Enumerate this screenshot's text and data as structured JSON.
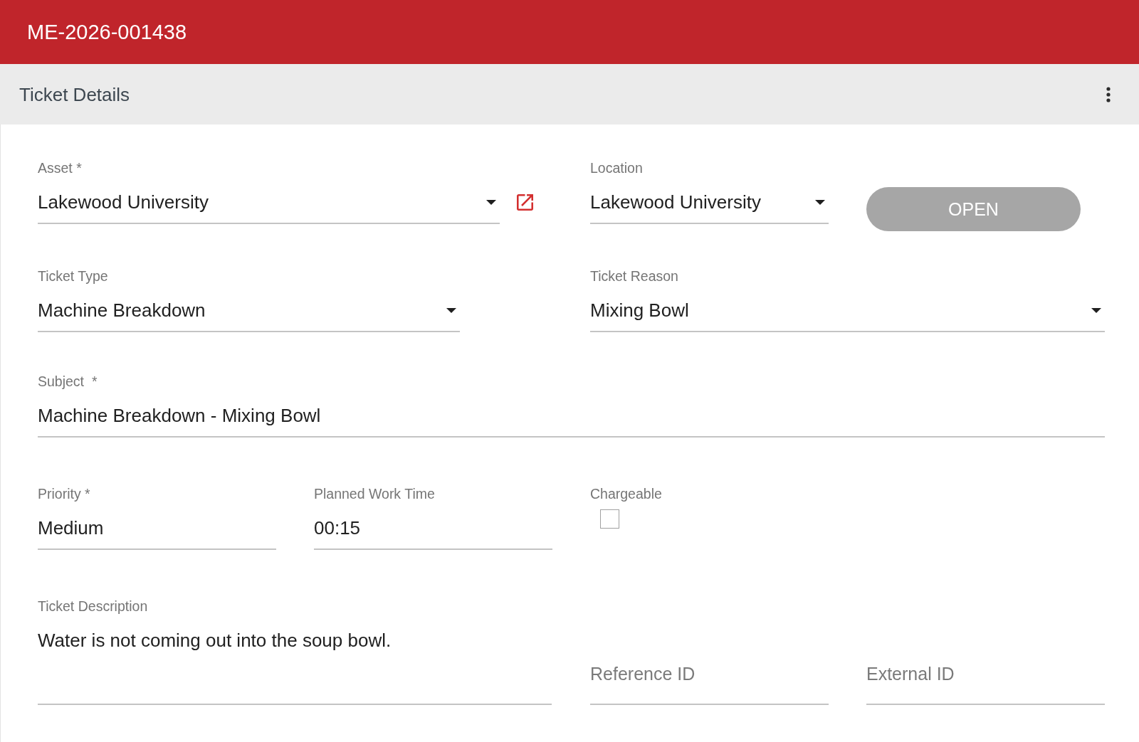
{
  "header": {
    "title": "ME-2026-001438"
  },
  "section": {
    "title": "Ticket Details"
  },
  "form": {
    "rows": [
      {
        "fields": [
          {
            "kind": "select",
            "label": "Asset *",
            "value": "Lakewood University",
            "external_link": true
          },
          {
            "kind": "select",
            "label": "Location",
            "value": "Lakewood University"
          },
          {
            "kind": "button",
            "label": "OPEN"
          }
        ]
      },
      {
        "fields": [
          {
            "kind": "select",
            "label": "Ticket Type",
            "value": "Machine Breakdown"
          },
          {
            "kind": "select",
            "label": "Ticket Reason",
            "value": "Mixing Bowl"
          }
        ]
      },
      {
        "fields": [
          {
            "kind": "text",
            "label": "Subject  *",
            "value": "Machine Breakdown - Mixing Bowl"
          }
        ]
      },
      {
        "fields": [
          {
            "kind": "text",
            "label": "Priority *",
            "value": "Medium"
          },
          {
            "kind": "text",
            "label": "Planned Work Time",
            "value": "00:15"
          },
          {
            "kind": "checkbox",
            "label": "Chargeable",
            "checked": false
          }
        ]
      },
      {
        "fields": [
          {
            "kind": "textarea",
            "label": "Ticket Description",
            "value": "Water is not coming out into the soup bowl."
          },
          {
            "kind": "placeholder",
            "placeholder": "Reference ID"
          },
          {
            "kind": "placeholder",
            "placeholder": "External ID"
          }
        ]
      }
    ]
  }
}
